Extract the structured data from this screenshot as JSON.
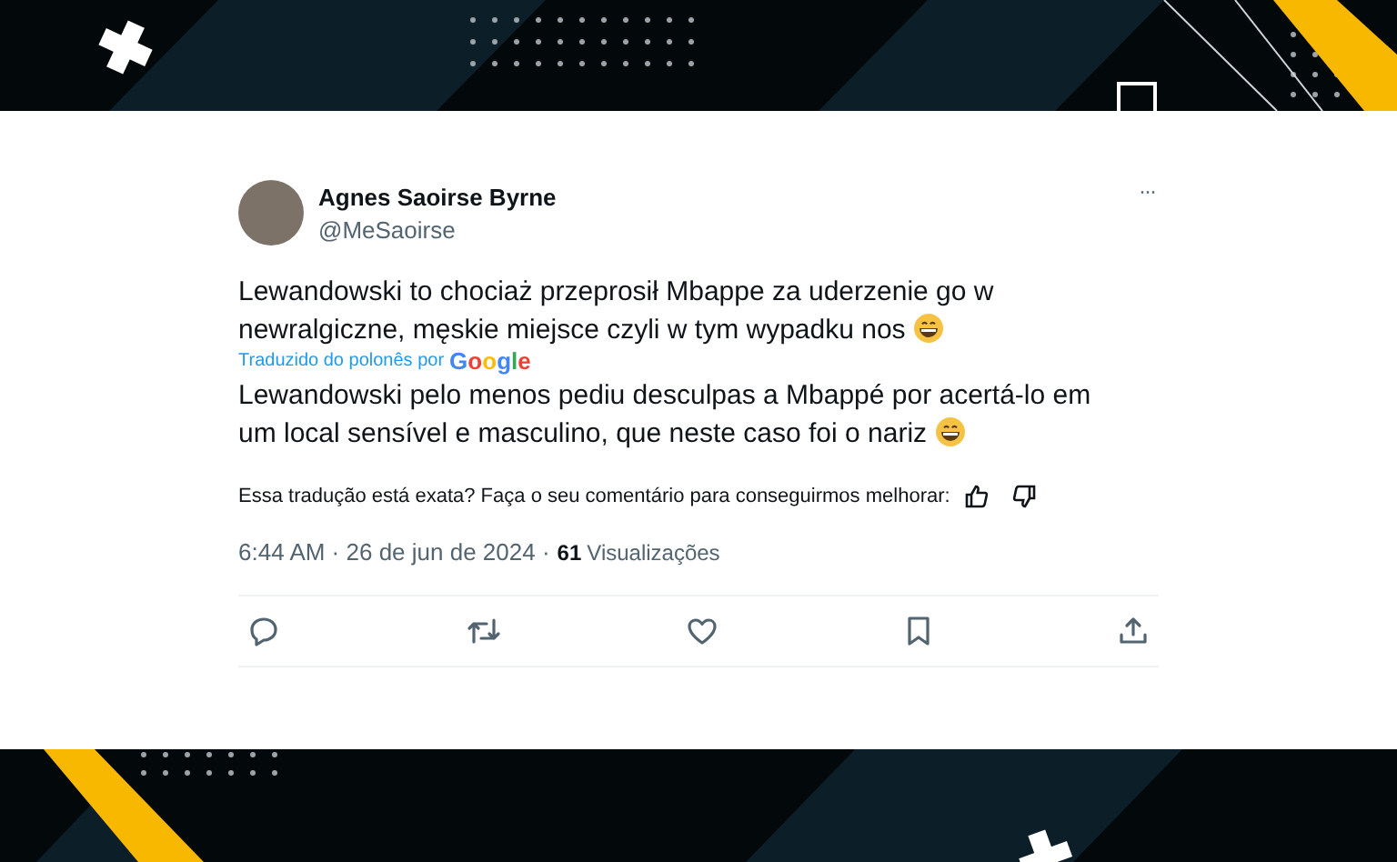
{
  "tweet": {
    "author": {
      "name": "Agnes Saoirse Byrne",
      "handle": "@MeSaoirse"
    },
    "more_button": "···",
    "text_lines": [
      "Lewandowski to chociaż przeprosił Mbappe za uderzenie go w",
      "newralgiczne, męskie miejsce czyli w tym wypadku nos"
    ],
    "translation": {
      "credit": "Traduzido do polonês por",
      "provider": "Google",
      "lines": [
        "Lewandowski pelo menos pediu desculpas a Mbappé por acertá-lo em",
        "um local sensível e masculino, que neste caso foi o nariz"
      ]
    },
    "feedback_prompt": "Essa tradução está exata? Faça o seu comentário para conseguirmos melhorar:",
    "timestamp": "6:44 AM · 26 de jun de 2024 ·",
    "views_count": "61",
    "views_label": "Visualizações",
    "actions": [
      {
        "kind": "reply"
      },
      {
        "kind": "retweet"
      },
      {
        "kind": "like"
      },
      {
        "kind": "bookmark"
      },
      {
        "kind": "share"
      }
    ]
  }
}
